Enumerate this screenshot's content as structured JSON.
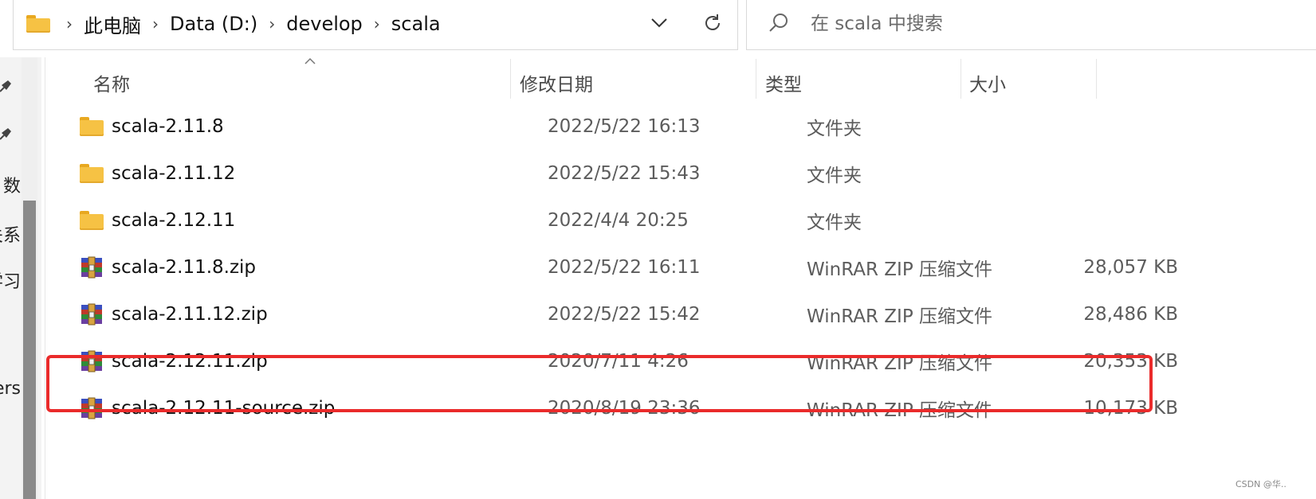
{
  "breadcrumb": {
    "items": [
      "此电脑",
      "Data (D:)",
      "develop",
      "scala"
    ],
    "separator": "›"
  },
  "search": {
    "placeholder": "在 scala 中搜索"
  },
  "nav_fragments": [
    "数",
    "关系",
    "学习",
    "ers"
  ],
  "columns": {
    "name": "名称",
    "modified": "修改日期",
    "type": "类型",
    "size": "大小"
  },
  "files": [
    {
      "name": "scala-2.11.8",
      "modified": "2022/5/22 16:13",
      "type": "文件夹",
      "size": "",
      "icon": "folder-icon"
    },
    {
      "name": "scala-2.11.12",
      "modified": "2022/5/22 15:43",
      "type": "文件夹",
      "size": "",
      "icon": "folder-icon"
    },
    {
      "name": "scala-2.12.11",
      "modified": "2022/4/4 20:25",
      "type": "文件夹",
      "size": "",
      "icon": "folder-icon"
    },
    {
      "name": "scala-2.11.8.zip",
      "modified": "2022/5/22 16:11",
      "type": "WinRAR ZIP 压缩文件",
      "size": "28,057 KB",
      "icon": "winrar-archive-icon"
    },
    {
      "name": "scala-2.11.12.zip",
      "modified": "2022/5/22 15:42",
      "type": "WinRAR ZIP 压缩文件",
      "size": "28,486 KB",
      "icon": "winrar-archive-icon"
    },
    {
      "name": "scala-2.12.11.zip",
      "modified": "2020/7/11 4:26",
      "type": "WinRAR ZIP 压缩文件",
      "size": "20,353 KB",
      "icon": "winrar-archive-icon",
      "highlighted": true
    },
    {
      "name": "scala-2.12.11-source.zip",
      "modified": "2020/8/19 23:36",
      "type": "WinRAR ZIP 压缩文件",
      "size": "10,173 KB",
      "icon": "winrar-archive-icon"
    }
  ],
  "colors": {
    "highlight": "#ea2b2b",
    "folder": "#f6c244",
    "scrollbar": "#8a8a8a"
  },
  "watermark": "CSDN @华.."
}
